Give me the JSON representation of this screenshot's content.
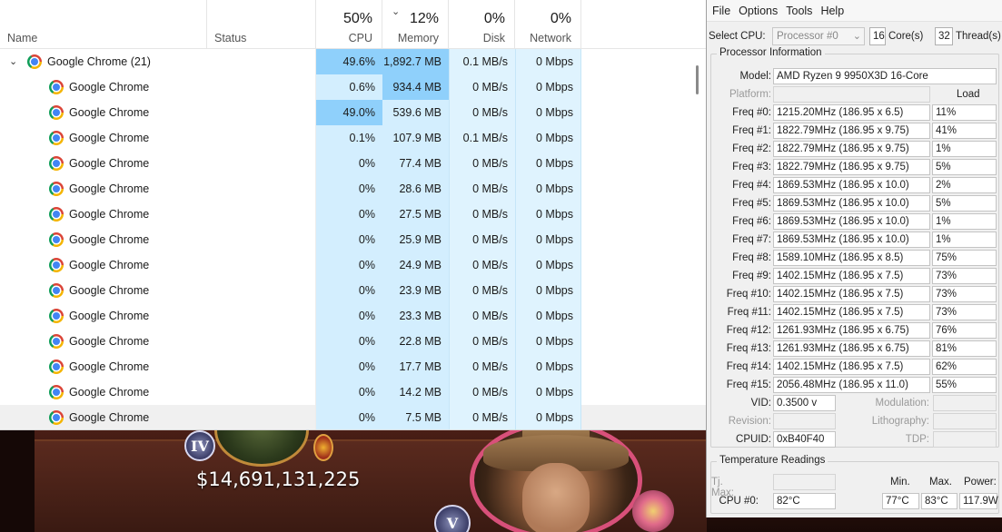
{
  "taskmgr": {
    "columns": {
      "name": "Name",
      "status": "Status",
      "cpu": {
        "pct": "50%",
        "label": "CPU"
      },
      "memory": {
        "pct": "12%",
        "label": "Memory"
      },
      "disk": {
        "pct": "0%",
        "label": "Disk"
      },
      "network": {
        "pct": "0%",
        "label": "Network"
      }
    },
    "group": {
      "name": "Google Chrome (21)",
      "cpu": "49.6%",
      "memory": "1,892.7 MB",
      "disk": "0.1 MB/s",
      "network": "0 Mbps"
    },
    "rows": [
      {
        "name": "Google Chrome",
        "cpu": "0.6%",
        "memory": "934.4 MB",
        "disk": "0 MB/s",
        "network": "0 Mbps"
      },
      {
        "name": "Google Chrome",
        "cpu": "49.0%",
        "memory": "539.6 MB",
        "disk": "0 MB/s",
        "network": "0 Mbps"
      },
      {
        "name": "Google Chrome",
        "cpu": "0.1%",
        "memory": "107.9 MB",
        "disk": "0.1 MB/s",
        "network": "0 Mbps"
      },
      {
        "name": "Google Chrome",
        "cpu": "0%",
        "memory": "77.4 MB",
        "disk": "0 MB/s",
        "network": "0 Mbps"
      },
      {
        "name": "Google Chrome",
        "cpu": "0%",
        "memory": "28.6 MB",
        "disk": "0 MB/s",
        "network": "0 Mbps"
      },
      {
        "name": "Google Chrome",
        "cpu": "0%",
        "memory": "27.5 MB",
        "disk": "0 MB/s",
        "network": "0 Mbps"
      },
      {
        "name": "Google Chrome",
        "cpu": "0%",
        "memory": "25.9 MB",
        "disk": "0 MB/s",
        "network": "0 Mbps"
      },
      {
        "name": "Google Chrome",
        "cpu": "0%",
        "memory": "24.9 MB",
        "disk": "0 MB/s",
        "network": "0 Mbps"
      },
      {
        "name": "Google Chrome",
        "cpu": "0%",
        "memory": "23.9 MB",
        "disk": "0 MB/s",
        "network": "0 Mbps"
      },
      {
        "name": "Google Chrome",
        "cpu": "0%",
        "memory": "23.3 MB",
        "disk": "0 MB/s",
        "network": "0 Mbps"
      },
      {
        "name": "Google Chrome",
        "cpu": "0%",
        "memory": "22.8 MB",
        "disk": "0 MB/s",
        "network": "0 Mbps"
      },
      {
        "name": "Google Chrome",
        "cpu": "0%",
        "memory": "17.7 MB",
        "disk": "0 MB/s",
        "network": "0 Mbps"
      },
      {
        "name": "Google Chrome",
        "cpu": "0%",
        "memory": "14.2 MB",
        "disk": "0 MB/s",
        "network": "0 Mbps"
      },
      {
        "name": "Google Chrome",
        "cpu": "0%",
        "memory": "7.5 MB",
        "disk": "0 MB/s",
        "network": "0 Mbps"
      }
    ]
  },
  "game": {
    "money": "$14,691,131,225",
    "rank_left": "IV",
    "rank_bottom": "V"
  },
  "cpuz": {
    "menu": [
      "File",
      "Options",
      "Tools",
      "Help"
    ],
    "select_cpu_label": "Select CPU:",
    "select_cpu_value": "Processor #0",
    "cores": "16",
    "cores_label": "Core(s)",
    "threads": "32",
    "threads_label": "Thread(s)",
    "proc_info_title": "Processor Information",
    "model_label": "Model:",
    "model": "AMD Ryzen 9 9950X3D 16-Core",
    "platform_label": "Platform:",
    "load_label": "Load",
    "freqs": [
      {
        "label": "Freq #0:",
        "value": "1215.20MHz (186.95 x 6.5)",
        "load": "11%"
      },
      {
        "label": "Freq #1:",
        "value": "1822.79MHz (186.95 x 9.75)",
        "load": "41%"
      },
      {
        "label": "Freq #2:",
        "value": "1822.79MHz (186.95 x 9.75)",
        "load": "1%"
      },
      {
        "label": "Freq #3:",
        "value": "1822.79MHz (186.95 x 9.75)",
        "load": "5%"
      },
      {
        "label": "Freq #4:",
        "value": "1869.53MHz (186.95 x 10.0)",
        "load": "2%"
      },
      {
        "label": "Freq #5:",
        "value": "1869.53MHz (186.95 x 10.0)",
        "load": "5%"
      },
      {
        "label": "Freq #6:",
        "value": "1869.53MHz (186.95 x 10.0)",
        "load": "1%"
      },
      {
        "label": "Freq #7:",
        "value": "1869.53MHz (186.95 x 10.0)",
        "load": "1%"
      },
      {
        "label": "Freq #8:",
        "value": "1589.10MHz (186.95 x 8.5)",
        "load": "75%"
      },
      {
        "label": "Freq #9:",
        "value": "1402.15MHz (186.95 x 7.5)",
        "load": "73%"
      },
      {
        "label": "Freq #10:",
        "value": "1402.15MHz (186.95 x 7.5)",
        "load": "73%"
      },
      {
        "label": "Freq #11:",
        "value": "1402.15MHz (186.95 x 7.5)",
        "load": "73%"
      },
      {
        "label": "Freq #12:",
        "value": "1261.93MHz (186.95 x 6.75)",
        "load": "76%"
      },
      {
        "label": "Freq #13:",
        "value": "1261.93MHz (186.95 x 6.75)",
        "load": "81%"
      },
      {
        "label": "Freq #14:",
        "value": "1402.15MHz (186.95 x 7.5)",
        "load": "62%"
      },
      {
        "label": "Freq #15:",
        "value": "2056.48MHz (186.95 x 11.0)",
        "load": "55%"
      }
    ],
    "vid_label": "VID:",
    "vid": "0.3500 v",
    "modulation_label": "Modulation:",
    "revision_label": "Revision:",
    "lithography_label": "Lithography:",
    "cpuid_label": "CPUID:",
    "cpuid": "0xB40F40",
    "tdp_label": "TDP:",
    "temp_title": "Temperature Readings",
    "tj_label": "Tj. Max:",
    "min_label": "Min.",
    "max_label": "Max.",
    "power_label": "Power:",
    "cpu0_label": "CPU #0:",
    "cpu0_temp": "82°C",
    "cpu0_min": "77°C",
    "cpu0_max": "83°C",
    "cpu0_power": "117.9W"
  }
}
